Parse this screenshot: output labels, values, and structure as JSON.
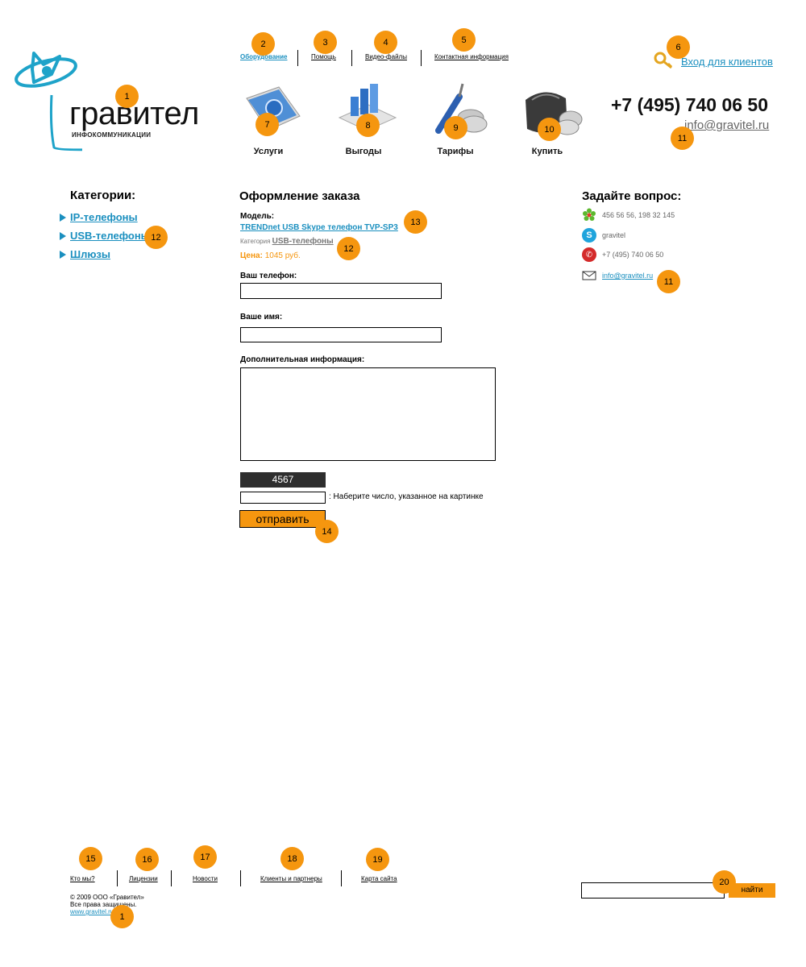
{
  "header": {
    "logo_text": "гравител",
    "logo_sub": "ИНФОКОММУНИКАЦИИ",
    "top_nav": [
      "Оборудование",
      "Помощь",
      "Видео-файлы",
      "Контактная информация"
    ],
    "login_label": "Вход для клиентов",
    "phone": "+7 (495) 740 06 50",
    "email": "info@gravitel.ru",
    "icon_nav": [
      "Услуги",
      "Выгоды",
      "Тарифы",
      "Купить"
    ]
  },
  "sidebar": {
    "title": "Категории:",
    "items": [
      "IP-телефоны",
      "USB-телефоны",
      "Шлюзы"
    ]
  },
  "order": {
    "title": "Оформление заказа",
    "model_label": "Модель:",
    "model_value": "TRENDnet USB Skype телефон TVP-SP3",
    "category_label": "Категория",
    "category_value": "USB-телефоны",
    "price_label": "Цена:",
    "price_value": "1045 руб.",
    "phone_label": "Ваш телефон:",
    "name_label": "Ваше имя:",
    "info_label": "Дополнительная информация:",
    "captcha_value": "4567",
    "captcha_hint": ": Наберите число, указанное на картинке",
    "submit_label": "отправить"
  },
  "ask": {
    "title": "Задайте вопрос:",
    "icq": "456 56 56, 198 32 145",
    "skype": "gravitel",
    "phone": "+7 (495) 740 06 50",
    "email": "info@gravitel.ru"
  },
  "footer": {
    "links": [
      "Кто мы?",
      "Лицензии",
      "Новости",
      "Клиенты и партнеры",
      "Карта сайта"
    ],
    "copyright_1": "© 2009 ООО «Гравител»",
    "copyright_2": "Все права защищены.",
    "website": "www.gravitel.ru",
    "search_button": "найти"
  },
  "badges": [
    "1",
    "2",
    "3",
    "4",
    "5",
    "6",
    "7",
    "8",
    "9",
    "10",
    "11",
    "12",
    "13",
    "14",
    "15",
    "16",
    "17",
    "18",
    "19",
    "20"
  ],
  "colors": {
    "accent": "#f5960f",
    "link": "#1a8fbf",
    "logo": "#1ea3c9"
  }
}
